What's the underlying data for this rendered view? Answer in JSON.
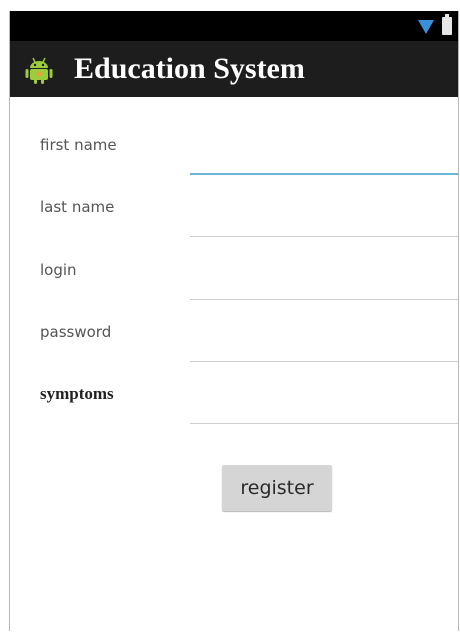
{
  "app": {
    "title": "Education System",
    "icon": "android-robot-icon"
  },
  "status_bar": {
    "icons": [
      "signal-icon",
      "battery-icon"
    ]
  },
  "form": {
    "fields": [
      {
        "label": "first name",
        "value": "",
        "focused": true
      },
      {
        "label": "last name",
        "value": ""
      },
      {
        "label": "login",
        "value": ""
      },
      {
        "label": "password",
        "value": ""
      },
      {
        "label": "symptoms",
        "value": ""
      }
    ],
    "register_label": "register"
  },
  "colors": {
    "status_bar": "#000000",
    "action_bar": "#1d1d1d",
    "focus_underline": "#6fb3d3",
    "button": "#d5d5d5",
    "android_green": "#9ccb3b"
  }
}
